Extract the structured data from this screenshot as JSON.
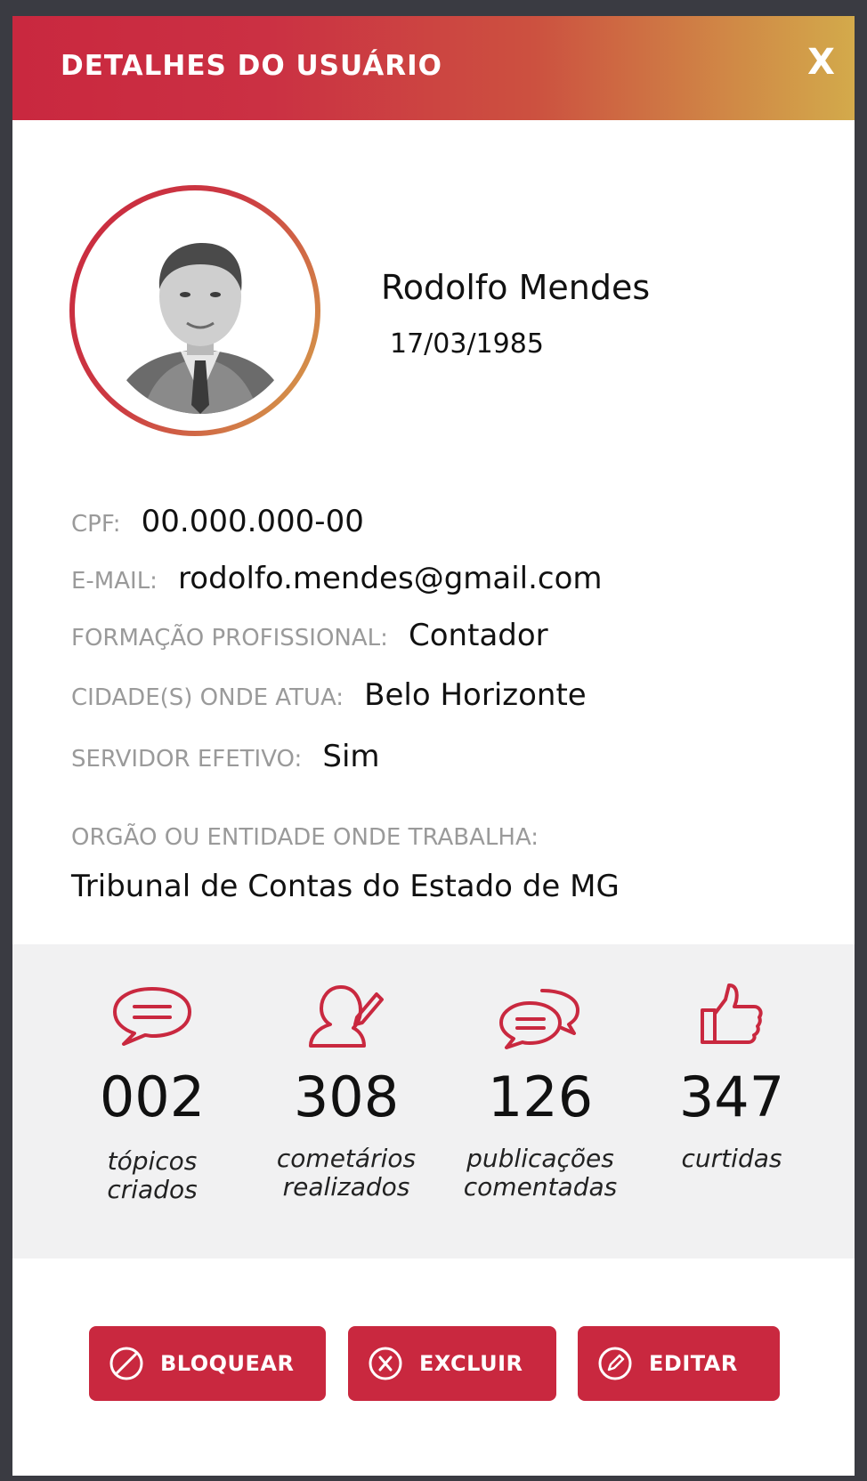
{
  "header": {
    "title": "DETALHES DO USUÁRIO",
    "close_label": "X"
  },
  "profile": {
    "name": "Rodolfo Mendes",
    "birth_date": "17/03/1985"
  },
  "fields": {
    "cpf": {
      "label": "CPF:",
      "value": "00.000.000-00"
    },
    "email": {
      "label": "E-MAIL:",
      "value": "rodolfo.mendes@gmail.com"
    },
    "formacao": {
      "label": "FORMAÇÃO PROFISSIONAL:",
      "value": "Contador"
    },
    "cidades": {
      "label": "CIDADE(S) ONDE ATUA:",
      "value": "Belo Horizonte"
    },
    "servidor": {
      "label": "SERVIDOR EFETIVO:",
      "value": "Sim"
    },
    "orgao": {
      "label": "ORGÃO OU ENTIDADE ONDE TRABALHA:",
      "value": "Tribunal de Contas do Estado de MG"
    }
  },
  "stats": [
    {
      "icon": "chat-bubble-icon",
      "value": "002",
      "label_line1": "tópicos",
      "label_line2": "criados"
    },
    {
      "icon": "user-edit-icon",
      "value": "308",
      "label_line1": "cometários",
      "label_line2": "realizados"
    },
    {
      "icon": "conversation-icon",
      "value": "126",
      "label_line1": "publicações",
      "label_line2": "comentadas"
    },
    {
      "icon": "thumbs-up-icon",
      "value": "347",
      "label_line1": "curtidas",
      "label_line2": ""
    }
  ],
  "actions": {
    "block_label": "BLOQUEAR",
    "delete_label": "EXCLUIR",
    "edit_label": "EDITAR"
  },
  "colors": {
    "accent": "#c9283f",
    "gradient_end": "#d3aa4b",
    "stats_background": "#f1f1f2",
    "label_gray": "#9a9a9a"
  }
}
